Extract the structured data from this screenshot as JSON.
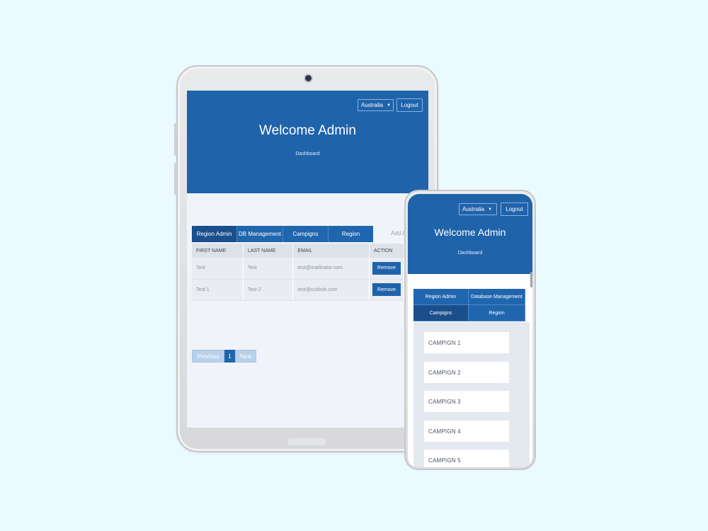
{
  "tablet": {
    "header": {
      "region_select": "Australia",
      "logout": "Logout",
      "title": "Welcome Admin",
      "subtitle": "Dashboard"
    },
    "tabs": [
      {
        "label": "Region Admin",
        "active": true
      },
      {
        "label": "DB Management",
        "active": false
      },
      {
        "label": "Campigns",
        "active": false
      },
      {
        "label": "Region",
        "active": false
      }
    ],
    "add_link": "Add A",
    "table": {
      "columns": [
        "FIRST NAME",
        "LAST NAME",
        "EMAIL",
        "ACTION"
      ],
      "rows": [
        {
          "first": "Test",
          "last": "Test",
          "email": "test@mailinator.com",
          "action": "Remove"
        },
        {
          "first": "Test 1",
          "last": "Test 2",
          "email": "test@outlook.com",
          "action": "Remove"
        }
      ]
    },
    "pager": {
      "previous": "Previous",
      "current": "1",
      "next": "Next"
    }
  },
  "phone": {
    "header": {
      "region_select": "Australia",
      "logout": "Logout",
      "title": "Welcome Admin",
      "subtitle": "Dashboard"
    },
    "tabs": [
      {
        "label": "Region Admin",
        "active": false
      },
      {
        "label": "Database Management",
        "active": false
      },
      {
        "label": "Campigns",
        "active": true
      },
      {
        "label": "Region",
        "active": false
      }
    ],
    "campaigns": [
      "CAMPIGN 1",
      "CAMPIGN 2",
      "CAMPIGN 3",
      "CAMPIGN 4",
      "CAMPIGN 5"
    ]
  },
  "colors": {
    "background": "#ebfaff",
    "primary": "#1f63ab",
    "active_tab": "#1a4f8c",
    "screen_bg": "#f0f4fa"
  }
}
